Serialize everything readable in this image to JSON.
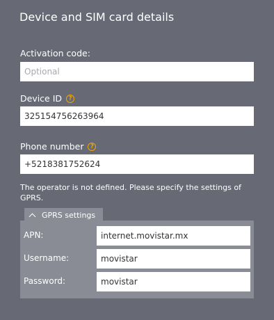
{
  "header": {
    "title": "Device and SIM card details"
  },
  "activation": {
    "label": "Activation code:",
    "placeholder": "Optional",
    "value": ""
  },
  "device": {
    "label": "Device ID",
    "value": "325154756263964"
  },
  "phone": {
    "label": "Phone number",
    "value": "+5218381752624"
  },
  "notice": "The operator is not defined. Please specify the settings of GPRS.",
  "gprs": {
    "title": "GPRS settings",
    "apn": {
      "label": "APN:",
      "value": "internet.movistar.mx"
    },
    "username": {
      "label": "Username:",
      "value": "movistar"
    },
    "password": {
      "label": "Password:",
      "value": "movistar"
    }
  },
  "colors": {
    "background": "#676a75",
    "panel": "#8a8c95",
    "help_icon": "#f0a500"
  },
  "icons": {
    "help": "help-circle-icon",
    "collapse": "chevron-up-icon"
  }
}
